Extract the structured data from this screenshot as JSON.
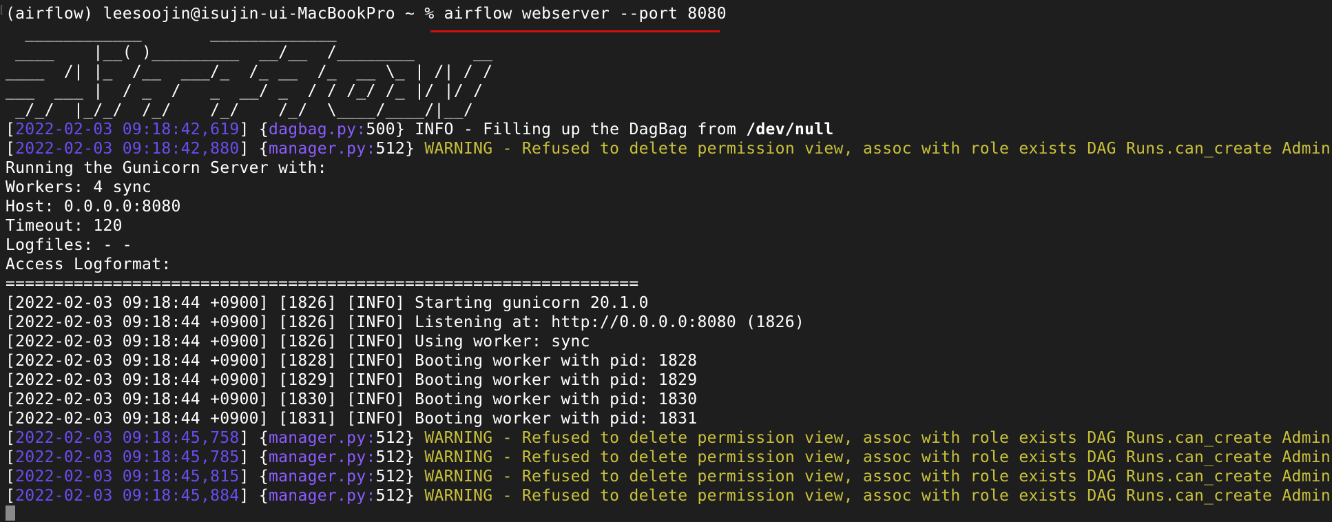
{
  "prompt": {
    "gutter": "[",
    "text": "(airflow) leesoojin@isujin-ui-MacBookPro ~ % ",
    "command": "airflow webserver --port 8080"
  },
  "ascii_art": [
    "  ____________       _____________",
    " ____    |__( )_________  __/__  /________      __",
    "____  /| |_  /__  ___/_  /_ __  /_  __ \\_ | /| / /",
    "___  ___ |  / _  /   _  __/ _  / / /_/ /_ |/ |/ /",
    " _/_/  |_/_/  /_/    /_/    /_/  \\____/____/|__/"
  ],
  "log_lines_1": [
    {
      "ts": "2022-02-03 09:18:42,619",
      "file": "dagbag.py:",
      "lineno": "500",
      "level": "INFO",
      "msg_prefix": " - Filling up the DagBag from ",
      "msg_bold": "/dev/null"
    },
    {
      "ts": "2022-02-03 09:18:42,880",
      "file": "manager.py:",
      "lineno": "512",
      "level": "WARNING",
      "msg": " - Refused to delete permission view, assoc with role exists DAG Runs.can_create Admin"
    }
  ],
  "gunicorn_info": [
    "Running the Gunicorn Server with:",
    "Workers: 4 sync",
    "Host: 0.0.0.0:8080",
    "Timeout: 120",
    "Logfiles: - -",
    "Access Logformat:",
    "================================================================="
  ],
  "gunicorn_logs": [
    "[2022-02-03 09:18:44 +0900] [1826] [INFO] Starting gunicorn 20.1.0",
    "[2022-02-03 09:18:44 +0900] [1826] [INFO] Listening at: http://0.0.0.0:8080 (1826)",
    "[2022-02-03 09:18:44 +0900] [1826] [INFO] Using worker: sync",
    "[2022-02-03 09:18:44 +0900] [1828] [INFO] Booting worker with pid: 1828",
    "[2022-02-03 09:18:44 +0900] [1829] [INFO] Booting worker with pid: 1829",
    "[2022-02-03 09:18:44 +0900] [1830] [INFO] Booting worker with pid: 1830",
    "[2022-02-03 09:18:44 +0900] [1831] [INFO] Booting worker with pid: 1831"
  ],
  "warning_lines": [
    {
      "ts": "2022-02-03 09:18:45,758",
      "file": "manager.py:",
      "lineno": "512",
      "msg": "WARNING - Refused to delete permission view, assoc with role exists DAG Runs.can_create Admin"
    },
    {
      "ts": "2022-02-03 09:18:45,785",
      "file": "manager.py:",
      "lineno": "512",
      "msg": "WARNING - Refused to delete permission view, assoc with role exists DAG Runs.can_create Admin"
    },
    {
      "ts": "2022-02-03 09:18:45,815",
      "file": "manager.py:",
      "lineno": "512",
      "msg": "WARNING - Refused to delete permission view, assoc with role exists DAG Runs.can_create Admin"
    },
    {
      "ts": "2022-02-03 09:18:45,884",
      "file": "manager.py:",
      "lineno": "512",
      "msg": "WARNING - Refused to delete permission view, assoc with role exists DAG Runs.can_create Admin"
    }
  ],
  "colors": {
    "background": "#1e1e1e",
    "text": "#ffffff",
    "timestamp": "#6c4cf0",
    "filename": "#8a5cff",
    "warning": "#c9c13a",
    "highlight_underline": "#d01010"
  }
}
